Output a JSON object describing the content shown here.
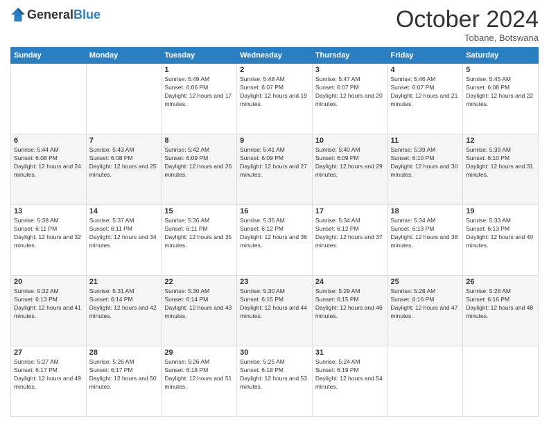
{
  "logo": {
    "general": "General",
    "blue": "Blue"
  },
  "header": {
    "month": "October 2024",
    "location": "Tobane, Botswana"
  },
  "weekdays": [
    "Sunday",
    "Monday",
    "Tuesday",
    "Wednesday",
    "Thursday",
    "Friday",
    "Saturday"
  ],
  "weeks": [
    [
      {
        "day": "",
        "sunrise": "",
        "sunset": "",
        "daylight": ""
      },
      {
        "day": "",
        "sunrise": "",
        "sunset": "",
        "daylight": ""
      },
      {
        "day": "1",
        "sunrise": "Sunrise: 5:49 AM",
        "sunset": "Sunset: 6:06 PM",
        "daylight": "Daylight: 12 hours and 17 minutes."
      },
      {
        "day": "2",
        "sunrise": "Sunrise: 5:48 AM",
        "sunset": "Sunset: 6:07 PM",
        "daylight": "Daylight: 12 hours and 19 minutes."
      },
      {
        "day": "3",
        "sunrise": "Sunrise: 5:47 AM",
        "sunset": "Sunset: 6:07 PM",
        "daylight": "Daylight: 12 hours and 20 minutes."
      },
      {
        "day": "4",
        "sunrise": "Sunrise: 5:46 AM",
        "sunset": "Sunset: 6:07 PM",
        "daylight": "Daylight: 12 hours and 21 minutes."
      },
      {
        "day": "5",
        "sunrise": "Sunrise: 5:45 AM",
        "sunset": "Sunset: 6:08 PM",
        "daylight": "Daylight: 12 hours and 22 minutes."
      }
    ],
    [
      {
        "day": "6",
        "sunrise": "Sunrise: 5:44 AM",
        "sunset": "Sunset: 6:08 PM",
        "daylight": "Daylight: 12 hours and 24 minutes."
      },
      {
        "day": "7",
        "sunrise": "Sunrise: 5:43 AM",
        "sunset": "Sunset: 6:08 PM",
        "daylight": "Daylight: 12 hours and 25 minutes."
      },
      {
        "day": "8",
        "sunrise": "Sunrise: 5:42 AM",
        "sunset": "Sunset: 6:09 PM",
        "daylight": "Daylight: 12 hours and 26 minutes."
      },
      {
        "day": "9",
        "sunrise": "Sunrise: 5:41 AM",
        "sunset": "Sunset: 6:09 PM",
        "daylight": "Daylight: 12 hours and 27 minutes."
      },
      {
        "day": "10",
        "sunrise": "Sunrise: 5:40 AM",
        "sunset": "Sunset: 6:09 PM",
        "daylight": "Daylight: 12 hours and 29 minutes."
      },
      {
        "day": "11",
        "sunrise": "Sunrise: 5:39 AM",
        "sunset": "Sunset: 6:10 PM",
        "daylight": "Daylight: 12 hours and 30 minutes."
      },
      {
        "day": "12",
        "sunrise": "Sunrise: 5:39 AM",
        "sunset": "Sunset: 6:10 PM",
        "daylight": "Daylight: 12 hours and 31 minutes."
      }
    ],
    [
      {
        "day": "13",
        "sunrise": "Sunrise: 5:38 AM",
        "sunset": "Sunset: 6:11 PM",
        "daylight": "Daylight: 12 hours and 32 minutes."
      },
      {
        "day": "14",
        "sunrise": "Sunrise: 5:37 AM",
        "sunset": "Sunset: 6:11 PM",
        "daylight": "Daylight: 12 hours and 34 minutes."
      },
      {
        "day": "15",
        "sunrise": "Sunrise: 5:36 AM",
        "sunset": "Sunset: 6:11 PM",
        "daylight": "Daylight: 12 hours and 35 minutes."
      },
      {
        "day": "16",
        "sunrise": "Sunrise: 5:35 AM",
        "sunset": "Sunset: 6:12 PM",
        "daylight": "Daylight: 12 hours and 36 minutes."
      },
      {
        "day": "17",
        "sunrise": "Sunrise: 5:34 AM",
        "sunset": "Sunset: 6:12 PM",
        "daylight": "Daylight: 12 hours and 37 minutes."
      },
      {
        "day": "18",
        "sunrise": "Sunrise: 5:34 AM",
        "sunset": "Sunset: 6:13 PM",
        "daylight": "Daylight: 12 hours and 38 minutes."
      },
      {
        "day": "19",
        "sunrise": "Sunrise: 5:33 AM",
        "sunset": "Sunset: 6:13 PM",
        "daylight": "Daylight: 12 hours and 40 minutes."
      }
    ],
    [
      {
        "day": "20",
        "sunrise": "Sunrise: 5:32 AM",
        "sunset": "Sunset: 6:13 PM",
        "daylight": "Daylight: 12 hours and 41 minutes."
      },
      {
        "day": "21",
        "sunrise": "Sunrise: 5:31 AM",
        "sunset": "Sunset: 6:14 PM",
        "daylight": "Daylight: 12 hours and 42 minutes."
      },
      {
        "day": "22",
        "sunrise": "Sunrise: 5:30 AM",
        "sunset": "Sunset: 6:14 PM",
        "daylight": "Daylight: 12 hours and 43 minutes."
      },
      {
        "day": "23",
        "sunrise": "Sunrise: 5:30 AM",
        "sunset": "Sunset: 6:15 PM",
        "daylight": "Daylight: 12 hours and 44 minutes."
      },
      {
        "day": "24",
        "sunrise": "Sunrise: 5:29 AM",
        "sunset": "Sunset: 6:15 PM",
        "daylight": "Daylight: 12 hours and 46 minutes."
      },
      {
        "day": "25",
        "sunrise": "Sunrise: 5:28 AM",
        "sunset": "Sunset: 6:16 PM",
        "daylight": "Daylight: 12 hours and 47 minutes."
      },
      {
        "day": "26",
        "sunrise": "Sunrise: 5:28 AM",
        "sunset": "Sunset: 6:16 PM",
        "daylight": "Daylight: 12 hours and 48 minutes."
      }
    ],
    [
      {
        "day": "27",
        "sunrise": "Sunrise: 5:27 AM",
        "sunset": "Sunset: 6:17 PM",
        "daylight": "Daylight: 12 hours and 49 minutes."
      },
      {
        "day": "28",
        "sunrise": "Sunrise: 5:26 AM",
        "sunset": "Sunset: 6:17 PM",
        "daylight": "Daylight: 12 hours and 50 minutes."
      },
      {
        "day": "29",
        "sunrise": "Sunrise: 5:26 AM",
        "sunset": "Sunset: 6:18 PM",
        "daylight": "Daylight: 12 hours and 51 minutes."
      },
      {
        "day": "30",
        "sunrise": "Sunrise: 5:25 AM",
        "sunset": "Sunset: 6:18 PM",
        "daylight": "Daylight: 12 hours and 53 minutes."
      },
      {
        "day": "31",
        "sunrise": "Sunrise: 5:24 AM",
        "sunset": "Sunset: 6:19 PM",
        "daylight": "Daylight: 12 hours and 54 minutes."
      },
      {
        "day": "",
        "sunrise": "",
        "sunset": "",
        "daylight": ""
      },
      {
        "day": "",
        "sunrise": "",
        "sunset": "",
        "daylight": ""
      }
    ]
  ]
}
